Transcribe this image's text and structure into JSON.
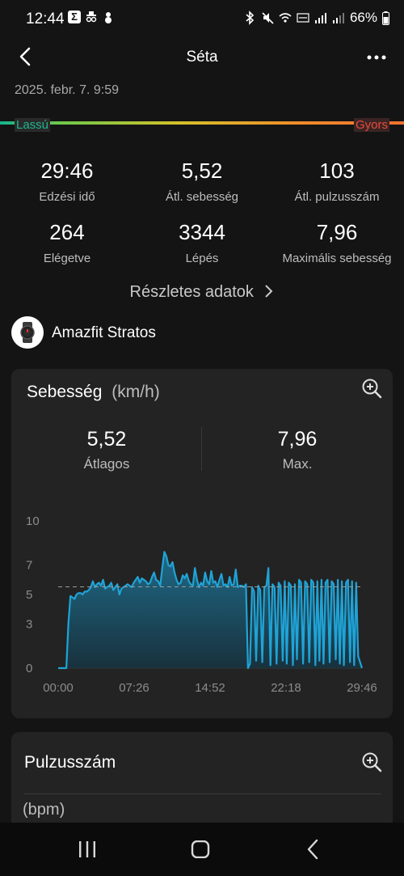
{
  "status": {
    "time": "12:44",
    "battery": "66%"
  },
  "header": {
    "title": "Séta",
    "date": "2025. febr. 7. 9:59"
  },
  "speed_bar": {
    "slow": "Lassú",
    "fast": "Gyors"
  },
  "stats": [
    {
      "value": "29:46",
      "label": "Edzési idő"
    },
    {
      "value": "5,52",
      "label": "Átl. sebesség"
    },
    {
      "value": "103",
      "label": "Átl. pulzusszám"
    },
    {
      "value": "264",
      "label": "Elégetve"
    },
    {
      "value": "3344",
      "label": "Lépés"
    },
    {
      "value": "7,96",
      "label": "Maximális sebesség"
    }
  ],
  "details_link": "Részletes adatok",
  "device": {
    "name": "Amazfit Stratos"
  },
  "speed_card": {
    "title": "Sebesség",
    "unit": "(km/h)",
    "avg_value": "5,52",
    "avg_label": "Átlagos",
    "max_value": "7,96",
    "max_label": "Max."
  },
  "chart_data": {
    "type": "area",
    "xlabel": "",
    "ylabel": "",
    "ylim": [
      0,
      10
    ],
    "y_ticks": [
      "0",
      "3",
      "5",
      "7",
      "10"
    ],
    "x_ticks": [
      "00:00",
      "07:26",
      "14:52",
      "22:18",
      "29:46"
    ],
    "average_line": 5.52,
    "grid": false,
    "color": "#1fa3d6",
    "series": [
      {
        "x": [
          0.0,
          0.2,
          0.4,
          0.6,
          0.8,
          1.0,
          1.2,
          1.4,
          1.6,
          1.8,
          2.0,
          2.2,
          2.4,
          2.6,
          2.8,
          3.0,
          3.2,
          3.4,
          3.6,
          3.8,
          4.0,
          4.2,
          4.4,
          4.6,
          4.8,
          5.0,
          5.2,
          5.4,
          5.6,
          5.8,
          6.0,
          6.2,
          6.4,
          6.6,
          6.8,
          7.0,
          7.2,
          7.4,
          7.6,
          7.8,
          8.0,
          8.2,
          8.4,
          8.6,
          8.8,
          9.0,
          9.2,
          9.4,
          9.6,
          9.8,
          10.0,
          10.2,
          10.4,
          10.6,
          10.8,
          11.0,
          11.2,
          11.4,
          11.6,
          11.8,
          12.0,
          12.2,
          12.4,
          12.6,
          12.8,
          13.0,
          13.2,
          13.4,
          13.6,
          13.8,
          14.0,
          14.2,
          14.4,
          14.6,
          14.8,
          15.0,
          15.2,
          15.4,
          15.6,
          15.8,
          16.0,
          16.2,
          16.4,
          16.6,
          16.8,
          17.0,
          17.2,
          17.4,
          17.6,
          17.8,
          18.0,
          18.2,
          18.4,
          18.6,
          18.8,
          19.0,
          19.2,
          19.4,
          19.6,
          19.8,
          20.0,
          20.2,
          20.4,
          20.6,
          20.8,
          21.0,
          21.2,
          21.4,
          21.6,
          21.8,
          22.0,
          22.2,
          22.4,
          22.6,
          22.8,
          23.0,
          23.2,
          23.4,
          23.6,
          23.8,
          24.0,
          24.2,
          24.4,
          24.6,
          24.8,
          25.0,
          25.2,
          25.4,
          25.6,
          25.8,
          26.0,
          26.2,
          26.4,
          26.6,
          26.8,
          27.0,
          27.2,
          27.4,
          27.6,
          27.8,
          28.0,
          28.2,
          28.4,
          28.6,
          28.8,
          29.0,
          29.2,
          29.4,
          29.77
        ],
        "values": [
          0,
          0,
          0,
          0,
          0,
          3,
          4.9,
          4.8,
          4.7,
          5.0,
          5.1,
          5.1,
          5.0,
          5.2,
          5.2,
          5.3,
          5.5,
          5.9,
          5.5,
          5.7,
          5.8,
          5.6,
          6.0,
          5.4,
          5.5,
          5.6,
          5.8,
          5.3,
          5.5,
          5.7,
          5.0,
          5.4,
          5.5,
          5.6,
          5.7,
          5.6,
          5.5,
          5.8,
          6.0,
          6.2,
          5.8,
          6.1,
          6.0,
          5.9,
          5.7,
          5.8,
          6.2,
          6.5,
          6.0,
          5.9,
          5.6,
          6.8,
          7.9,
          7.6,
          7.0,
          6.9,
          7.2,
          6.5,
          6.0,
          5.7,
          5.8,
          6.3,
          6.1,
          6.4,
          5.9,
          5.7,
          5.6,
          6.8,
          6.0,
          5.5,
          5.8,
          5.6,
          6.5,
          5.9,
          5.7,
          6.6,
          5.8,
          5.9,
          5.5,
          6.0,
          6.4,
          5.6,
          5.7,
          5.5,
          6.2,
          5.6,
          5.7,
          6.7,
          5.5,
          5.6,
          5.6,
          5.5,
          5.7,
          0,
          0.3,
          5.5,
          5.2,
          0.5,
          5.6,
          5.3,
          0.4,
          5.5,
          5.6,
          6.8,
          0.2,
          5.7,
          5.5,
          0.3,
          5.8,
          5.6,
          0.5,
          5.9,
          0.3,
          5.8,
          5.6,
          0.2,
          5.7,
          0.6,
          6.0,
          5.8,
          0.3,
          5.9,
          5.7,
          0.4,
          6.0,
          5.8,
          0.2,
          5.9,
          0.5,
          6.0,
          0.3,
          5.8,
          6.0,
          0.4,
          5.9,
          5.7,
          0.6,
          6.0,
          0.3,
          5.9,
          0.2,
          5.8,
          6.0,
          0.4,
          5.9,
          0.2,
          5.8,
          0.8,
          0
        ]
      }
    ]
  },
  "pulse_card": {
    "title": "Pulzusszám",
    "unit": "(bpm)"
  }
}
